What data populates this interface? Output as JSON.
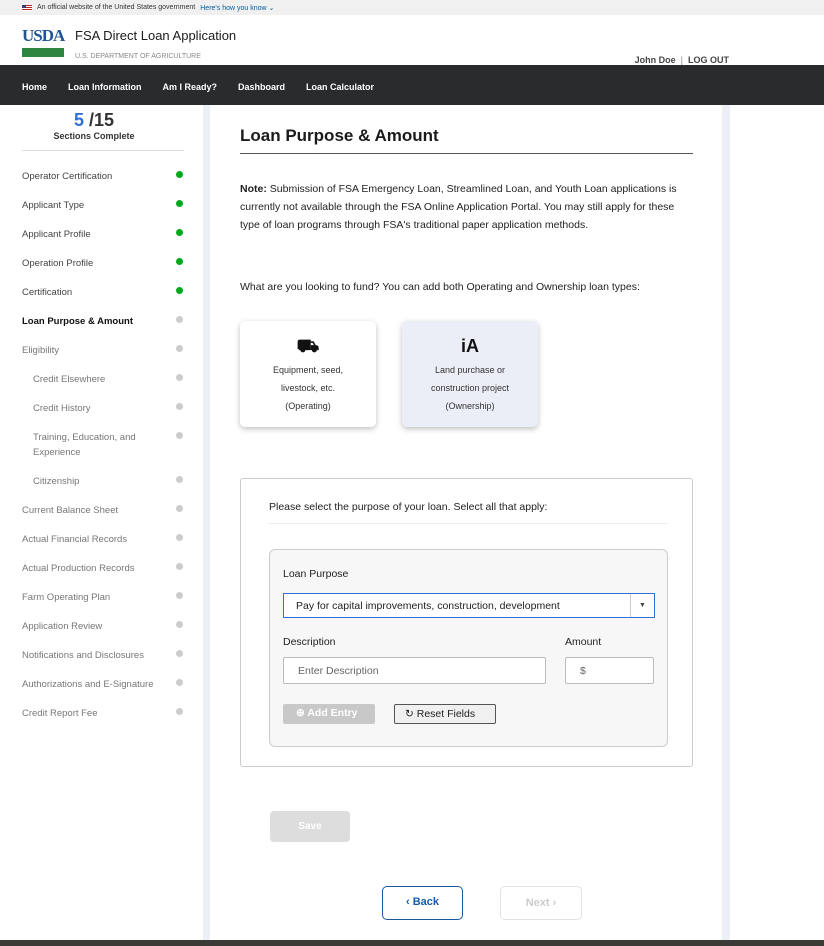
{
  "banner": {
    "text": "An official website of the United States government",
    "link": "Here's how you know"
  },
  "header": {
    "logo": "USDA",
    "title": "FSA Direct Loan Application",
    "dept": "U.S. DEPARTMENT OF AGRICULTURE",
    "user": "John Doe",
    "sep": "|",
    "logout": "LOG OUT"
  },
  "nav": [
    "Home",
    "Loan Information",
    "Am I Ready?",
    "Dashboard",
    "Loan Calculator"
  ],
  "progress": {
    "done": "5",
    "total": "/15",
    "label": "Sections Complete"
  },
  "sections": [
    {
      "label": "Operator Certification",
      "complete": true
    },
    {
      "label": "Applicant Type",
      "complete": true
    },
    {
      "label": "Applicant Profile",
      "complete": true
    },
    {
      "label": "Operation Profile",
      "complete": true
    },
    {
      "label": "Certification",
      "complete": true
    },
    {
      "label": "Loan Purpose & Amount",
      "complete": false,
      "current": true
    },
    {
      "label": "Eligibility",
      "complete": false
    },
    {
      "label": "Credit Elsewhere",
      "complete": false,
      "sub": true
    },
    {
      "label": "Credit History",
      "complete": false,
      "sub": true
    },
    {
      "label": "Training, Education, and Experience",
      "complete": false,
      "sub": true
    },
    {
      "label": "Citizenship",
      "complete": false,
      "sub": true
    },
    {
      "label": "Current Balance Sheet",
      "complete": false
    },
    {
      "label": "Actual Financial Records",
      "complete": false
    },
    {
      "label": "Actual Production Records",
      "complete": false
    },
    {
      "label": "Farm Operating Plan",
      "complete": false
    },
    {
      "label": "Application Review",
      "complete": false
    },
    {
      "label": "Notifications and Disclosures",
      "complete": false
    },
    {
      "label": "Authorizations and E-Signature",
      "complete": false
    },
    {
      "label": "Credit Report Fee",
      "complete": false
    }
  ],
  "main": {
    "title": "Loan Purpose & Amount",
    "note_label": "Note:",
    "note": " Submission of FSA Emergency Loan, Streamlined Loan, and Youth Loan applications is currently not available through the FSA Online Application Portal. You may still apply for these type of loan programs through FSA's traditional paper application methods.",
    "question": "What are you looking to fund? You can add both Operating and Ownership loan types:",
    "options": [
      {
        "line1": "Equipment, seed,",
        "line2": "livestock, etc.",
        "line3": "(Operating)",
        "icon": "tractor-icon"
      },
      {
        "line1": "Land purchase or",
        "line2": "construction project",
        "line3": "(Ownership)",
        "icon": "barn-icon"
      }
    ],
    "instruction": "Please select the purpose of your loan. Select all that apply:",
    "purpose_label": "Loan Purpose",
    "purpose_value": "Pay for capital improvements, construction, development",
    "description_label": "Description",
    "description_placeholder": "Enter Description",
    "amount_label": "Amount",
    "amount_prefix": "$",
    "add_entry": "Add Entry",
    "reset": "Reset Fields",
    "save": "Save",
    "back": "Back",
    "next": "Next"
  }
}
